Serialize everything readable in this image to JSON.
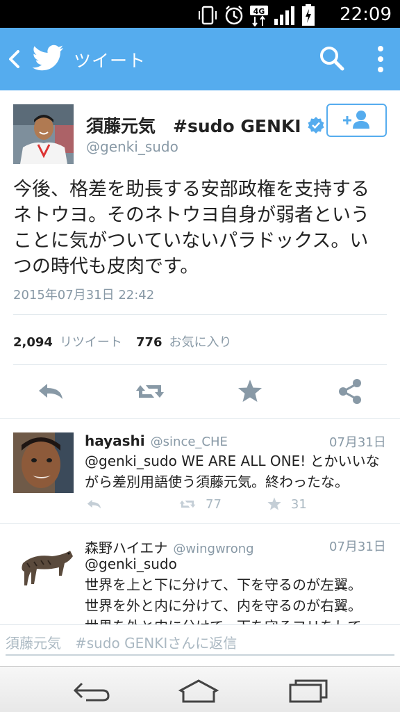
{
  "status_bar": {
    "time": "22:09",
    "network": "4G",
    "icons": [
      "vibrate-icon",
      "alarm-icon",
      "network-4g-icon",
      "signal-icon",
      "battery-charging-icon"
    ]
  },
  "app_bar": {
    "title": "ツイート",
    "background": "#55acee",
    "icons": [
      "back-icon",
      "twitter-bird-icon",
      "search-icon",
      "more-vert-icon"
    ]
  },
  "tweet": {
    "display_name": "須藤元気　#sudo GENKI",
    "handle": "@genki_sudo",
    "verified": true,
    "text": "今後、格差を助長する安部政権を支持するネトウヨ。そのネトウヨ自身が弱者ということに気がついていないパラドックス。いつの時代も皮肉です。",
    "date": "2015年07月31日 22:42",
    "retweets": "2,094",
    "retweets_label": "リツイート",
    "favorites": "776",
    "favorites_label": "お気に入り"
  },
  "replies": [
    {
      "name": "hayashi",
      "handle": "@since_CHE",
      "date": "07月31日",
      "text_line1": "@genki_sudo WE ARE ALL ONE! とかいいな",
      "text_line2": "がら差別用語使う須藤元気。終わったな。",
      "retweets": "77",
      "favorites": "31"
    },
    {
      "name": "森野ハイエナ",
      "handle": "@wingwrong",
      "date": "07月31日",
      "text_line1": "@genki_sudo",
      "text_line2": "世界を上と下に分けて、下を守るのが左翼。",
      "text_line3": "世界を外と内に分けて、内を守るのが右翼。",
      "text_line4": "世界を外と内に分けて、下を守るフリをして"
    }
  ],
  "compose": {
    "placeholder": "須藤元気　#sudo GENKIさんに返信"
  },
  "colors": {
    "accent": "#55acee",
    "muted": "#8899a6",
    "favorite": "#aab8c2"
  }
}
